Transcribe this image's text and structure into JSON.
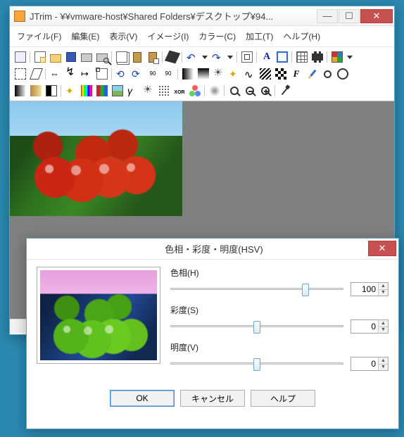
{
  "main_window": {
    "title": "JTrim - ¥¥vmware-host¥Shared Folders¥デスクトップ¥94..."
  },
  "menu": {
    "file": "ファイル(F)",
    "edit": "編集(E)",
    "view": "表示(V)",
    "image": "イメージ(I)",
    "color": "カラー(C)",
    "process": "加工(T)",
    "help": "ヘルプ(H)"
  },
  "toolbar_icons": {
    "r1": [
      "window",
      "new",
      "open",
      "save",
      "print",
      "print-preview",
      "copy",
      "paste",
      "paste-new",
      "fill",
      "undo",
      "redo",
      "fit",
      "letter-a",
      "frame",
      "grid",
      "film",
      "palette"
    ],
    "r2": [
      "crop",
      "skew",
      "flip-h",
      "flip-v",
      "shift",
      "resize",
      "rotate-l",
      "rotate-r",
      "rot-free",
      "rot-180",
      "grad-h",
      "grad-v",
      "sun",
      "sparkle",
      "wave",
      "stripes",
      "checker",
      "filter-f",
      "pencil",
      "circ1",
      "circ2"
    ],
    "r3": [
      "grad-a",
      "grad-b",
      "split",
      "sparkle2",
      "hue",
      "palette2",
      "img1",
      "gamma",
      "sun2",
      "dots",
      "xor",
      "rgb",
      "blur",
      "mag",
      "mag-minus",
      "mag-plus",
      "picker"
    ]
  },
  "dialog": {
    "title": "色相・彩度・明度(HSV)",
    "hue_label": "色相(H)",
    "hue_value": "100",
    "sat_label": "彩度(S)",
    "sat_value": "0",
    "val_label": "明度(V)",
    "val_value": "0",
    "ok": "OK",
    "cancel": "キャンセル",
    "help": "ヘルプ"
  }
}
